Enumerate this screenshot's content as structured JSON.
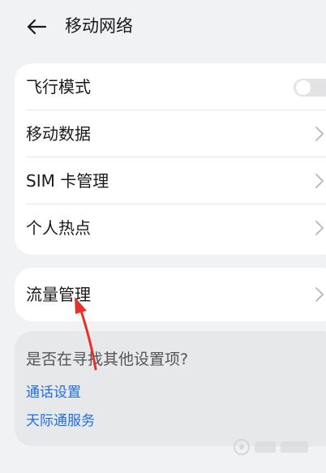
{
  "header": {
    "title": "移动网络",
    "back_icon": "arrow-left-icon"
  },
  "main_card": {
    "items": [
      {
        "label": "飞行模式",
        "control": "toggle",
        "toggle_on": false
      },
      {
        "label": "移动数据",
        "control": "chevron"
      },
      {
        "label": "SIM 卡管理",
        "control": "chevron"
      },
      {
        "label": "个人热点",
        "control": "chevron"
      }
    ]
  },
  "flow_card": {
    "label": "流量管理",
    "control": "chevron"
  },
  "help_card": {
    "question": "是否在寻找其他设置项?",
    "links": [
      "通话设置",
      "天际通服务"
    ]
  },
  "annotation": {
    "icon": "red-arrow-annotation",
    "color": "#e8302a"
  },
  "watermark": {
    "icon": "baidu-jingyan-watermark"
  },
  "colors": {
    "background": "#f1f2f4",
    "card": "#ffffff",
    "link": "#1f6fe0",
    "toggle_off": "#e3e3e6"
  }
}
